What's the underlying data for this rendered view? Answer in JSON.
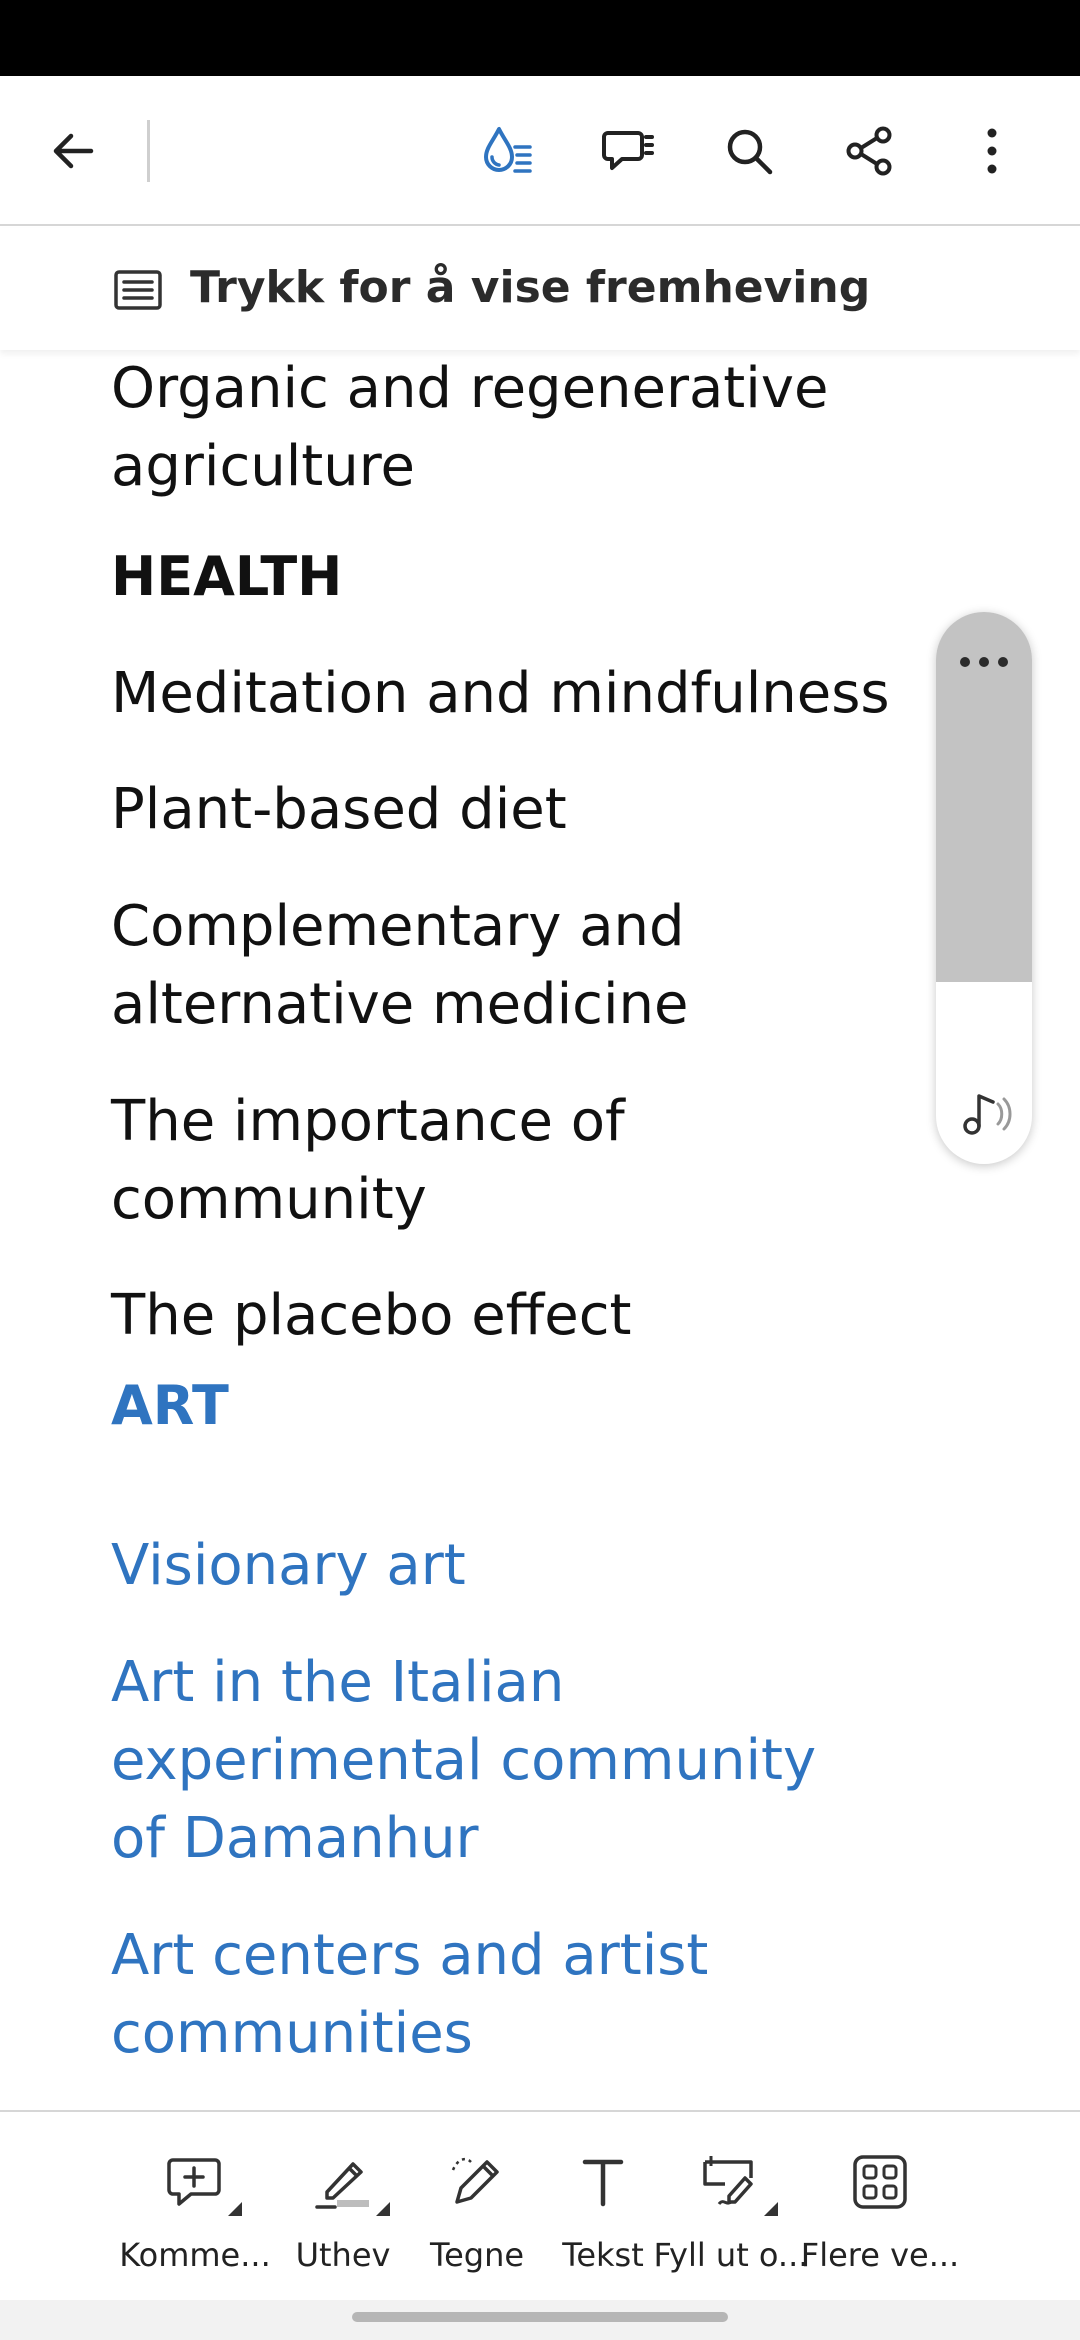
{
  "hint": {
    "text": "Trykk for å vise fremheving"
  },
  "document": {
    "items": [
      {
        "text": "Organic and regenerative agriculture",
        "style": "body"
      },
      {
        "text": "HEALTH",
        "style": "heading"
      },
      {
        "text": "Meditation and mindfulness",
        "style": "body"
      },
      {
        "text": "Plant-based diet",
        "style": "body"
      },
      {
        "text": "Complementary and alternative medicine",
        "style": "body"
      },
      {
        "text": "The importance of community",
        "style": "body"
      },
      {
        "text": "The placebo effect",
        "style": "body"
      },
      {
        "text": "ART",
        "style": "heading-link"
      },
      {
        "text": "Visionary art",
        "style": "link"
      },
      {
        "text": "Art in the Italian experimental community of Damanhur",
        "style": "link"
      },
      {
        "text": "Art centers and artist communities",
        "style": "link"
      }
    ]
  },
  "tools": [
    {
      "label": "Komme...",
      "icon": "comment-add-icon"
    },
    {
      "label": "Uthev",
      "icon": "highlighter-icon"
    },
    {
      "label": "Tegne",
      "icon": "draw-pencil-icon"
    },
    {
      "label": "Tekst",
      "icon": "text-icon"
    },
    {
      "label": "Fyll ut o...",
      "icon": "fill-sign-icon"
    },
    {
      "label": "Flere ve...",
      "icon": "more-tools-grid-icon"
    }
  ],
  "colors": {
    "accent": "#2f74c0",
    "text": "#111111",
    "status_bar": "#000000"
  }
}
